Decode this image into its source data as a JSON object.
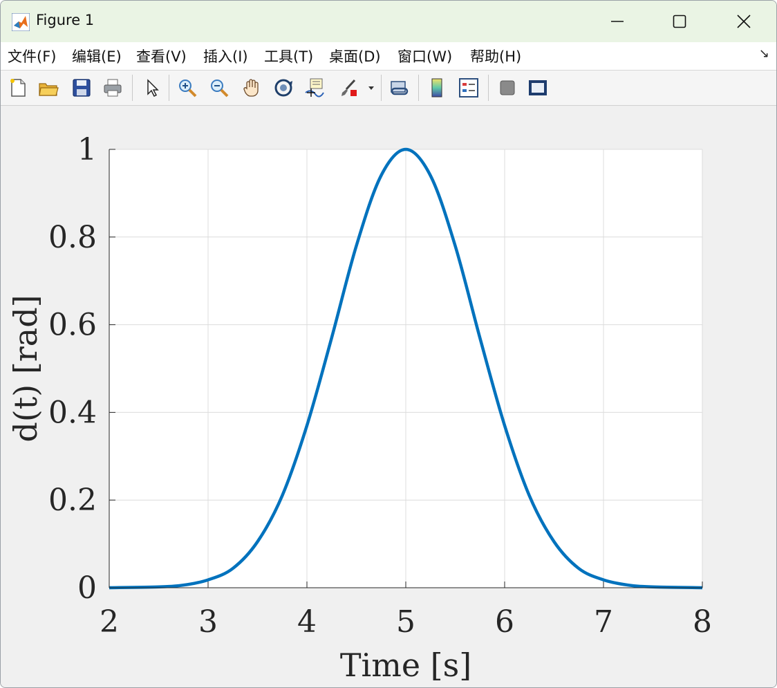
{
  "window": {
    "title": "Figure 1",
    "minimize_icon": "minimize-icon",
    "maximize_icon": "maximize-icon",
    "close_icon": "close-icon"
  },
  "menu": {
    "items": [
      {
        "label": "文件(F)"
      },
      {
        "label": "编辑(E)"
      },
      {
        "label": "查看(V)"
      },
      {
        "label": "插入(I)"
      },
      {
        "label": "工具(T)"
      },
      {
        "label": "桌面(D)"
      },
      {
        "label": "窗口(W)"
      },
      {
        "label": "帮助(H)"
      }
    ],
    "expand_icon": "↘"
  },
  "toolbar": {
    "icons": [
      "new-figure-icon",
      "open-file-icon",
      "save-icon",
      "print-icon",
      "pointer-icon",
      "zoom-in-icon",
      "zoom-out-icon",
      "pan-hand-icon",
      "rotate-3d-icon",
      "data-cursor-icon",
      "brush-icon",
      "link-plot-icon",
      "colorbar-icon",
      "legend-icon",
      "hide-plot-tools-icon",
      "show-plot-tools-icon"
    ]
  },
  "chart_data": {
    "type": "line",
    "xlabel": "Time [s]",
    "ylabel": "d(t) [rad]",
    "xlim": [
      2,
      8
    ],
    "ylim": [
      0,
      1
    ],
    "xticks": [
      "2",
      "3",
      "4",
      "5",
      "6",
      "7",
      "8"
    ],
    "yticks": [
      "0",
      "0.2",
      "0.4",
      "0.6",
      "0.8",
      "1"
    ],
    "grid": true,
    "series": [
      {
        "color": "#0072BD",
        "x": [
          2.0,
          2.5,
          2.75,
          3.0,
          3.25,
          3.5,
          3.75,
          4.0,
          4.25,
          4.5,
          4.75,
          5.0,
          5.25,
          5.5,
          5.75,
          6.0,
          6.25,
          6.5,
          6.75,
          7.0,
          7.25,
          7.5,
          8.0
        ],
        "y": [
          0.0,
          0.002,
          0.006,
          0.018,
          0.044,
          0.105,
          0.21,
          0.37,
          0.57,
          0.78,
          0.94,
          1.0,
          0.94,
          0.78,
          0.57,
          0.37,
          0.21,
          0.105,
          0.044,
          0.018,
          0.006,
          0.002,
          0.0
        ]
      }
    ]
  }
}
